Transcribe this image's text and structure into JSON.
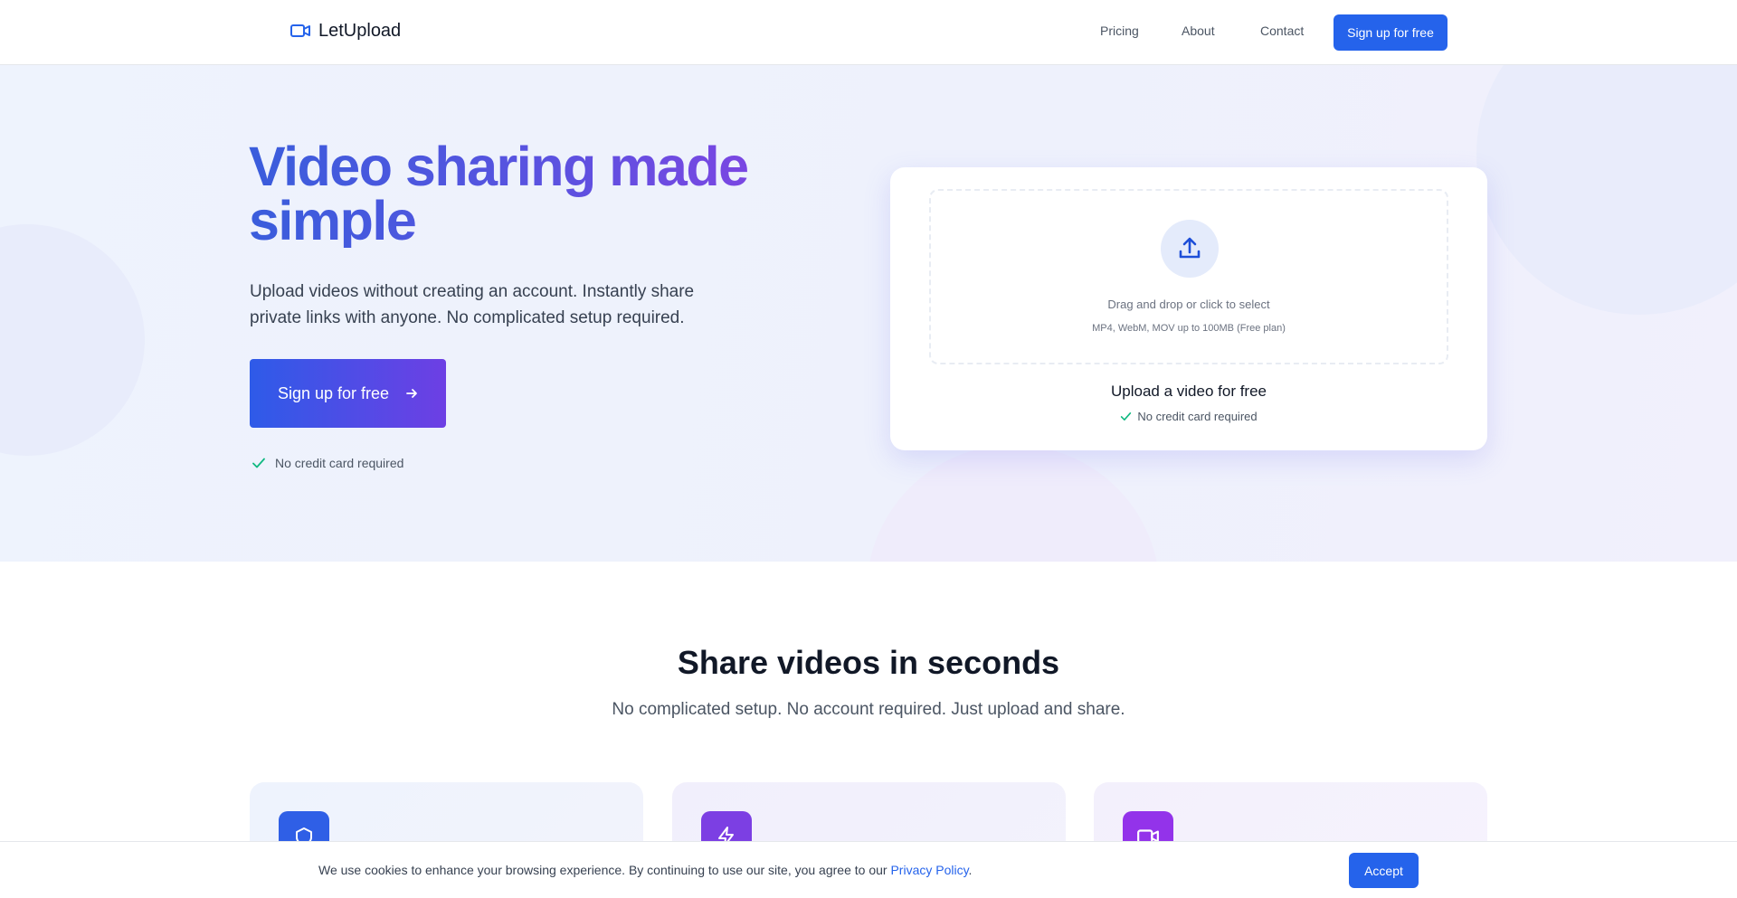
{
  "brand": {
    "name": "LetUpload",
    "icon": "video-camera-icon",
    "accent_color": "#2563eb"
  },
  "nav": {
    "links": [
      "Pricing",
      "About",
      "Contact"
    ],
    "cta_label": "Sign up for free"
  },
  "hero": {
    "title": "Video sharing made simple",
    "subtitle": "Upload videos without creating an account. Instantly share private links with anyone. No complicated setup required.",
    "cta_label": "Sign up for free",
    "cta_icon": "arrow-right-icon",
    "note": "No credit card required"
  },
  "upload_card": {
    "icon": "upload-icon",
    "drop_text": "Drag and drop or click to select",
    "formats": "MP4, WebM, MOV up to 100MB (Free plan)",
    "title": "Upload a video for free",
    "note": "No credit card required"
  },
  "features": {
    "title": "Share videos in seconds",
    "subtitle": "No complicated setup. No account required. Just upload and share.",
    "cards": [
      {
        "icon": "shield-icon",
        "color": "#2f5fe6"
      },
      {
        "icon": "lightning-icon",
        "color": "#7c3fe3"
      },
      {
        "icon": "video-camera-icon",
        "color": "#9333ea"
      }
    ]
  },
  "cookie": {
    "text": "We use cookies to enhance your browsing experience. By continuing to use our site, you agree to our ",
    "link_label": "Privacy Policy",
    "text_end": ".",
    "accept_label": "Accept"
  }
}
